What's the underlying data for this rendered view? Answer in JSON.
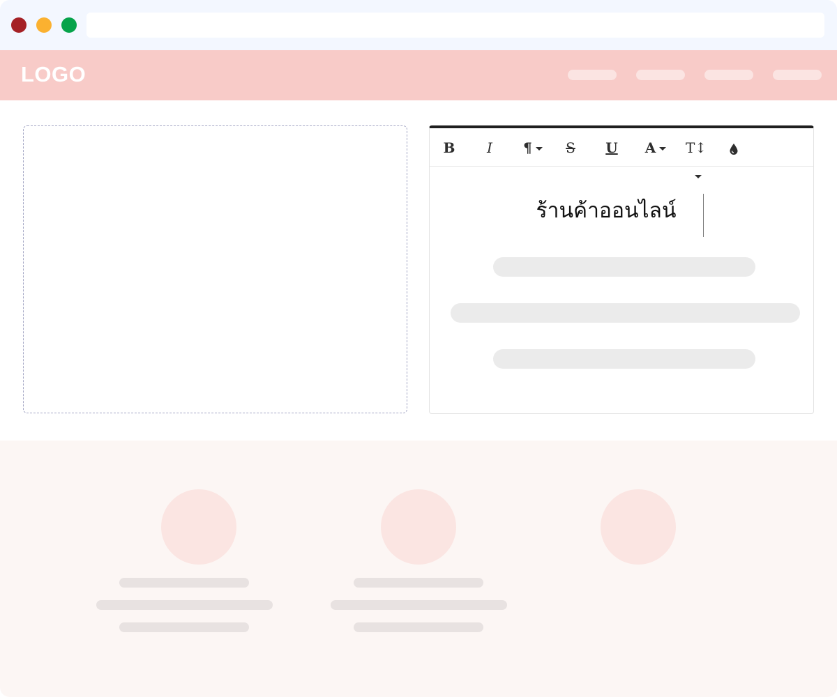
{
  "window": {
    "controls": [
      "close",
      "minimize",
      "maximize"
    ],
    "address_bar": ""
  },
  "site": {
    "logo_text": "LOGO",
    "nav_items": 4
  },
  "editor": {
    "toolbar": [
      {
        "name": "bold-button",
        "label": "B",
        "dropdown": false
      },
      {
        "name": "italic-button",
        "label": "I",
        "dropdown": false
      },
      {
        "name": "paragraph-button",
        "label": "¶",
        "dropdown": true
      },
      {
        "name": "strikethrough-button",
        "label": "S",
        "dropdown": false
      },
      {
        "name": "underline-button",
        "label": "U",
        "dropdown": false
      },
      {
        "name": "font-color-button",
        "label": "A",
        "dropdown": true
      },
      {
        "name": "font-size-button",
        "label": "T↕",
        "dropdown": true
      },
      {
        "name": "highlight-color-button",
        "label": "💧",
        "dropdown": false
      }
    ],
    "heading_text": "ร้านค้าออนไลน์"
  },
  "colors": {
    "titlebar": "#f3f7ff",
    "navbar": "#f8cbc8",
    "accent_close": "#a52126",
    "accent_minimize": "#fbb130",
    "accent_maximize": "#06a34a",
    "features_bg": "#fcf6f4"
  }
}
